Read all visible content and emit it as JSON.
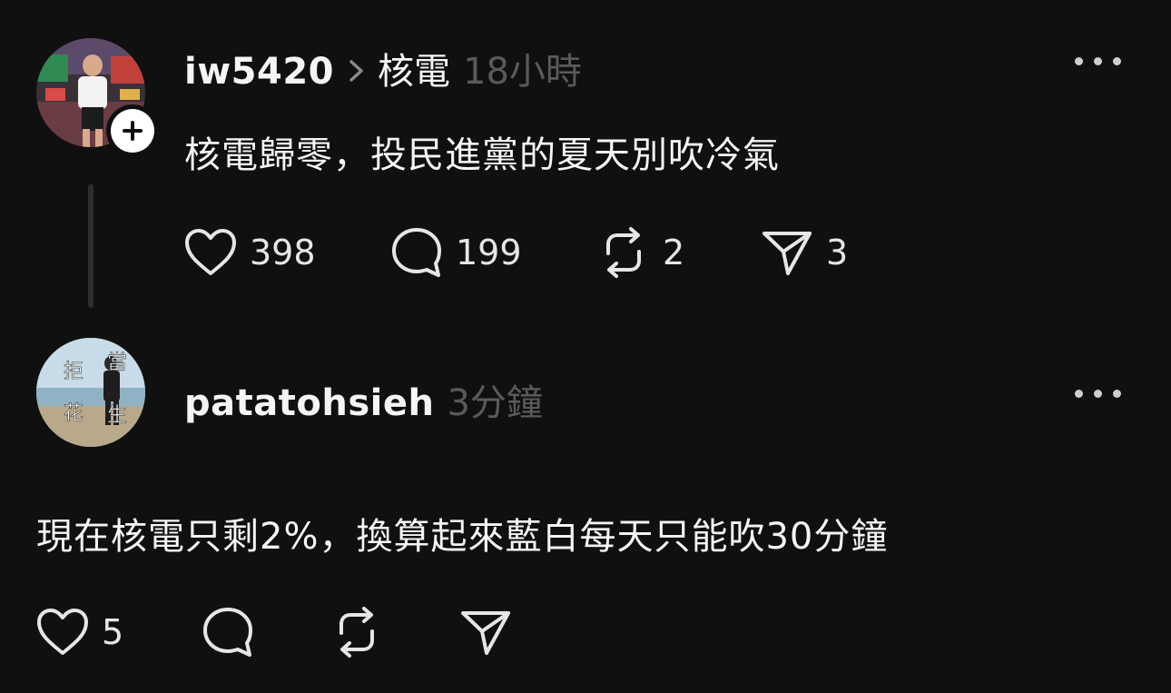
{
  "post": {
    "username": "iw5420",
    "topic": "核電",
    "time": "18小時",
    "text": "核電歸零，投民進黨的夏天別吹冷氣",
    "follow_icon": "plus-icon",
    "actions": {
      "like_count": "398",
      "reply_count": "199",
      "repost_count": "2",
      "share_count": "3"
    }
  },
  "reply": {
    "username": "patatohsieh",
    "time": "3分鐘",
    "avatar_text": [
      "拒",
      "當",
      "花",
      "生"
    ],
    "text": "現在核電只剩2%，換算起來藍白每天只能吹30分鐘",
    "actions": {
      "like_count": "5"
    }
  },
  "colors": {
    "background": "#101010",
    "text_primary": "#f3f5f7",
    "text_secondary": "#5a5a5a",
    "thread_line": "#2e2e2e"
  }
}
